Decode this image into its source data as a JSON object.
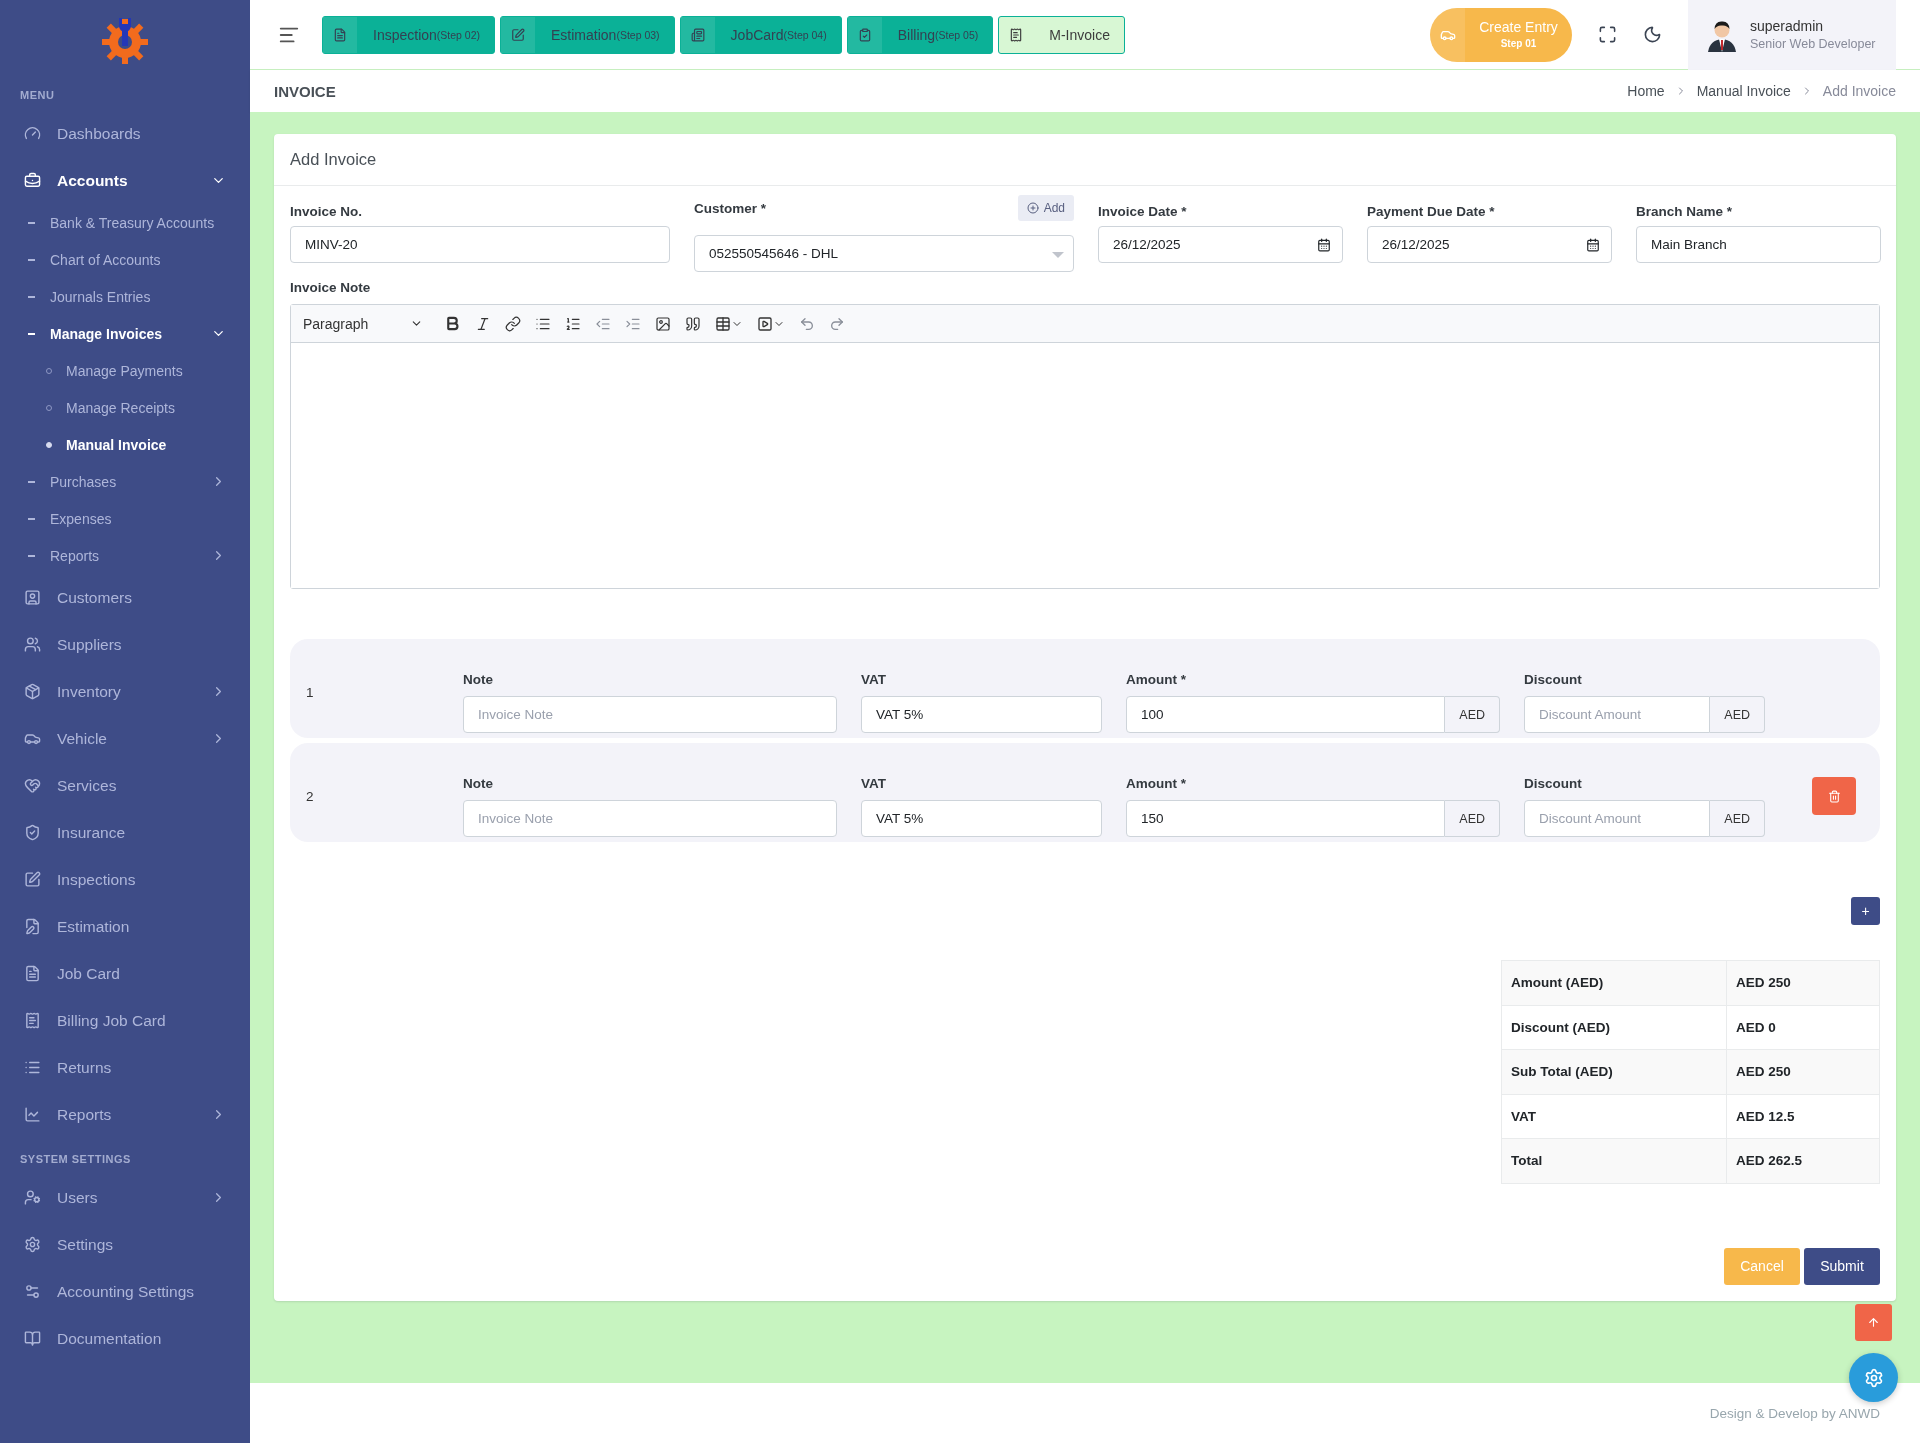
{
  "sidebar": {
    "sections": [
      {
        "title": "MENU",
        "items": [
          {
            "label": "Dashboards",
            "selected": false
          },
          {
            "label": "Accounts",
            "expanded": true,
            "children": [
              {
                "label": "Bank & Treasury Accounts",
                "selected": false
              },
              {
                "label": "Chart of Accounts",
                "selected": false
              },
              {
                "label": "Journals Entries",
                "selected": false
              },
              {
                "label": "Manage Invoices",
                "expanded": true,
                "children": [
                  {
                    "label": "Manage Payments",
                    "selected": false
                  },
                  {
                    "label": "Manage Receipts",
                    "selected": false
                  },
                  {
                    "label": "Manual Invoice",
                    "selected": true
                  }
                ]
              },
              {
                "label": "Purchases",
                "selected": false,
                "expanded": false
              },
              {
                "label": "Expenses",
                "selected": false
              },
              {
                "label": "Reports",
                "selected": false,
                "expanded": false
              }
            ]
          },
          {
            "label": "Customers",
            "selected": false
          },
          {
            "label": "Suppliers",
            "selected": false
          },
          {
            "label": "Inventory",
            "selected": false,
            "expanded": false
          },
          {
            "label": "Vehicle",
            "selected": false,
            "expanded": false
          },
          {
            "label": "Services",
            "selected": false
          },
          {
            "label": "Insurance",
            "selected": false
          },
          {
            "label": "Inspections",
            "selected": false
          },
          {
            "label": "Estimation",
            "selected": false
          },
          {
            "label": "Job Card",
            "selected": false
          },
          {
            "label": "Billing Job Card",
            "selected": false
          },
          {
            "label": "Returns",
            "selected": false
          },
          {
            "label": "Reports",
            "selected": false,
            "expanded": false
          }
        ]
      },
      {
        "title": "SYSTEM SETTINGS",
        "items": [
          {
            "label": "Users",
            "selected": false,
            "expanded": false
          },
          {
            "label": "Settings",
            "selected": false
          },
          {
            "label": "Accounting Settings",
            "selected": false
          },
          {
            "label": "Documentation",
            "selected": false
          }
        ]
      }
    ]
  },
  "header": {
    "step_tabs": [
      {
        "label": "Inspection",
        "step": "(Step 02)",
        "selected": false
      },
      {
        "label": "Estimation",
        "step": "(Step 03)",
        "selected": false
      },
      {
        "label": "JobCard",
        "step": "(Step 04)",
        "selected": false
      },
      {
        "label": "Billing",
        "step": "(Step 05)",
        "selected": false
      },
      {
        "label": "M-Invoice",
        "selected": true
      }
    ],
    "create_entry": {
      "label": "Create Entry",
      "step": "Step 01"
    },
    "user": {
      "name": "superadmin",
      "role": "Senior Web Developer"
    }
  },
  "page_title": "INVOICE",
  "breadcrumb": [
    {
      "label": "Home",
      "current": false
    },
    {
      "label": "Manual Invoice",
      "current": false
    },
    {
      "label": "Add Invoice",
      "current": true
    }
  ],
  "card": {
    "title": "Add Invoice",
    "fields": [
      {
        "kind": "text",
        "label": "Invoice No.",
        "value": "MINV-20"
      },
      {
        "kind": "select",
        "label": "Customer *",
        "value": "052550545646 - DHL",
        "action": "Add"
      },
      {
        "kind": "date",
        "label": "Invoice Date *",
        "value": "26/12/2025"
      },
      {
        "kind": "date",
        "label": "Payment Due Date *",
        "value": "26/12/2025"
      },
      {
        "kind": "text",
        "label": "Branch Name *",
        "value": "Main Branch"
      }
    ],
    "note_editor": {
      "label": "Invoice Note",
      "block_style": "Paragraph"
    },
    "line_items": [
      {
        "index": "1",
        "deletable": false,
        "fields": [
          {
            "label": "Note",
            "placeholder": "Invoice Note"
          },
          {
            "label": "VAT",
            "value": "VAT 5%"
          },
          {
            "label": "Amount *",
            "value": "100",
            "suffix": "AED"
          },
          {
            "label": "Discount",
            "placeholder": "Discount Amount",
            "suffix": "AED"
          }
        ]
      },
      {
        "index": "2",
        "deletable": true,
        "fields": [
          {
            "label": "Note",
            "placeholder": "Invoice Note"
          },
          {
            "label": "VAT",
            "value": "VAT 5%"
          },
          {
            "label": "Amount *",
            "value": "150",
            "suffix": "AED"
          },
          {
            "label": "Discount",
            "placeholder": "Discount Amount",
            "suffix": "AED"
          }
        ]
      }
    ],
    "add_row_button": "+",
    "totals": [
      {
        "label": "Amount (AED)",
        "value": "AED 250"
      },
      {
        "label": "Discount (AED)",
        "value": "AED 0"
      },
      {
        "label": "Sub Total (AED)",
        "value": "AED 250"
      },
      {
        "label": "VAT",
        "value": "AED 12.5"
      },
      {
        "label": "Total",
        "value": "AED 262.5"
      }
    ],
    "buttons": [
      {
        "kind": "cancel",
        "label": "Cancel"
      },
      {
        "kind": "submit",
        "label": "Submit"
      }
    ]
  },
  "footer": "Design & Develop by ANWD"
}
